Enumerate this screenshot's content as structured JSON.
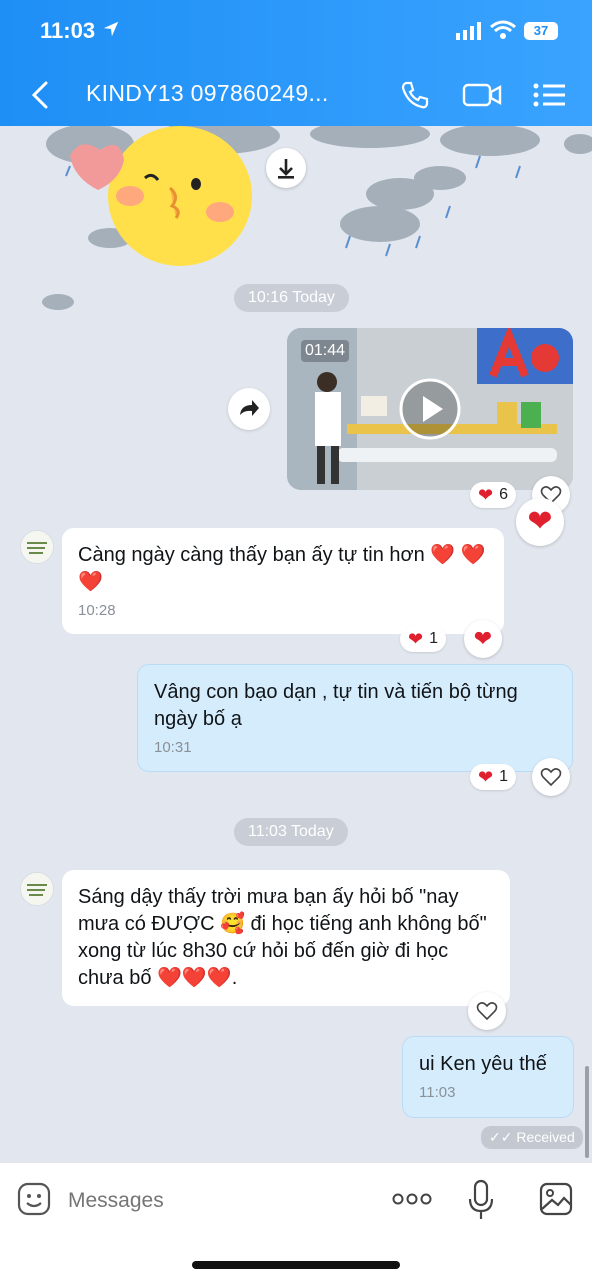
{
  "status": {
    "time": "11:03",
    "battery": "37"
  },
  "header": {
    "title": "KINDY13 097860249..."
  },
  "timeline": [
    {
      "time_label": "10:16 Today"
    },
    {
      "time_label": "11:03 Today"
    }
  ],
  "video": {
    "duration": "01:44",
    "reaction_count": "6"
  },
  "messages": [
    {
      "direction": "in",
      "text": "Càng ngày càng thấy bạn ấy tự tin hơn ❤️ ❤️❤️",
      "time": "10:28",
      "reaction_count": "1"
    },
    {
      "direction": "out",
      "text": "Vâng con bạo dạn , tự tin và tiến bộ từng ngày bố ạ",
      "time": "10:31",
      "reaction_count": "1"
    },
    {
      "direction": "in",
      "text": "Sáng dậy thấy trời mưa bạn ấy hỏi bố \"nay mưa có ĐƯỢC 🥰 đi học tiếng anh không bố\" xong từ lúc 8h30 cứ hỏi bố đến giờ đi học chưa bố ❤️❤️❤️.",
      "time": ""
    },
    {
      "direction": "out",
      "text": "ui Ken yêu thế",
      "time": "11:03",
      "status": "Received"
    }
  ],
  "composer": {
    "placeholder": "Messages"
  },
  "colors": {
    "accent": "#1e8ff5",
    "out_bubble": "#d5ecfd",
    "heart": "#e0202f"
  }
}
